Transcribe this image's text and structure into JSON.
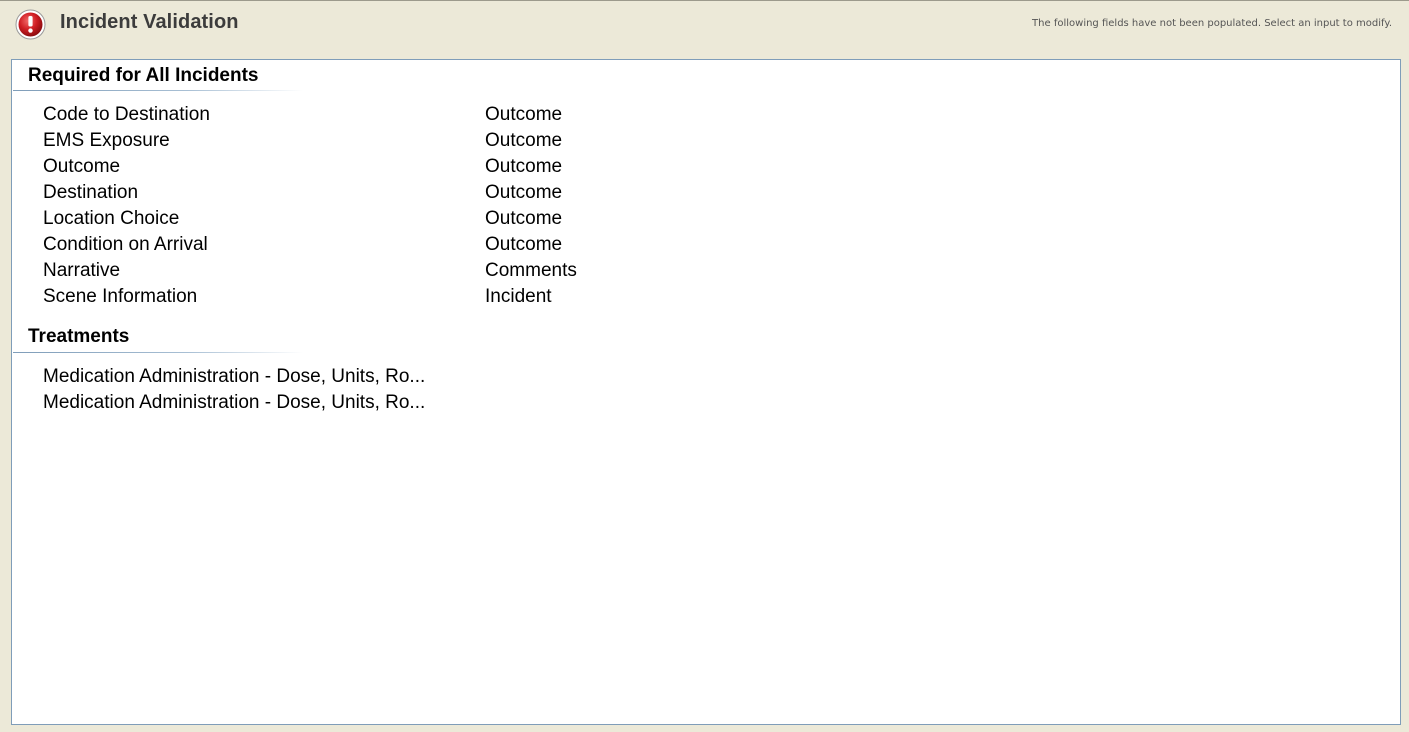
{
  "header": {
    "title": "Incident Validation",
    "message": "The following fields have not been populated. Select an input to modify.",
    "icon": "alert-icon"
  },
  "colors": {
    "background": "#ece9d8",
    "panel_background": "#ffffff",
    "panel_border": "#7f9db9",
    "icon_red": "#c8161d"
  },
  "sections": [
    {
      "title": "Required for All Incidents",
      "rows": [
        {
          "field": "Code to Destination",
          "page": "Outcome"
        },
        {
          "field": "EMS Exposure",
          "page": "Outcome"
        },
        {
          "field": "Outcome",
          "page": "Outcome"
        },
        {
          "field": "Destination",
          "page": "Outcome"
        },
        {
          "field": "Location Choice",
          "page": "Outcome"
        },
        {
          "field": "Condition on Arrival",
          "page": "Outcome"
        },
        {
          "field": "Narrative",
          "page": "Comments"
        },
        {
          "field": "Scene Information",
          "page": "Incident"
        }
      ]
    },
    {
      "title": "Treatments",
      "rows": [
        {
          "field": "Medication Administration - Dose, Units, Ro...",
          "page": ""
        },
        {
          "field": "Medication Administration - Dose, Units, Ro...",
          "page": ""
        }
      ]
    }
  ]
}
